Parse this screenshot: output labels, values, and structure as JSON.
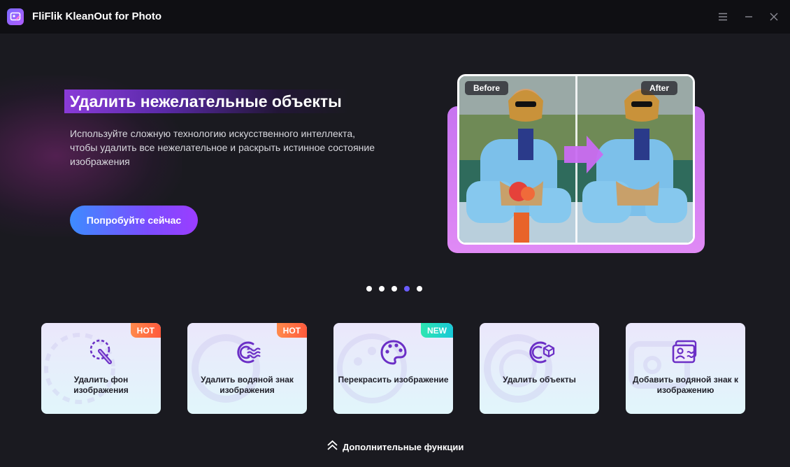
{
  "app": {
    "title": "FliFlik KleanOut for Photo"
  },
  "window_controls": {
    "menu_icon": "menu-icon",
    "minimize_icon": "minimize-icon",
    "close_icon": "close-icon"
  },
  "hero": {
    "title": "Удалить нежелательные объекты",
    "description": "Используйте сложную технологию искусственного интеллекта, чтобы удалить все нежелательное и раскрыть истинное состояние изображения",
    "cta_label": "Попробуйте сейчас",
    "before_label": "Before",
    "after_label": "After"
  },
  "carousel": {
    "count": 5,
    "active_index": 3
  },
  "features": [
    {
      "label": "Удалить фон изображения",
      "badge": "HOT",
      "icon": "eraser-brush-icon"
    },
    {
      "label": "Удалить водяной знак изображения",
      "badge": "HOT",
      "icon": "watermark-wave-icon"
    },
    {
      "label": "Перекрасить изображение",
      "badge": "NEW",
      "icon": "palette-icon"
    },
    {
      "label": "Удалить объекты",
      "badge": "",
      "icon": "object-cube-icon"
    },
    {
      "label": "Добавить водяной знак к изображению",
      "badge": "",
      "icon": "add-watermark-image-icon"
    }
  ],
  "more": {
    "label": "Дополнительные функции",
    "icon": "double-chevron-up-icon"
  },
  "colors": {
    "accent": "#6a5cff",
    "icon_purple": "#6b2fc6",
    "hot": "#ff6a43",
    "new": "#20d8c0"
  }
}
